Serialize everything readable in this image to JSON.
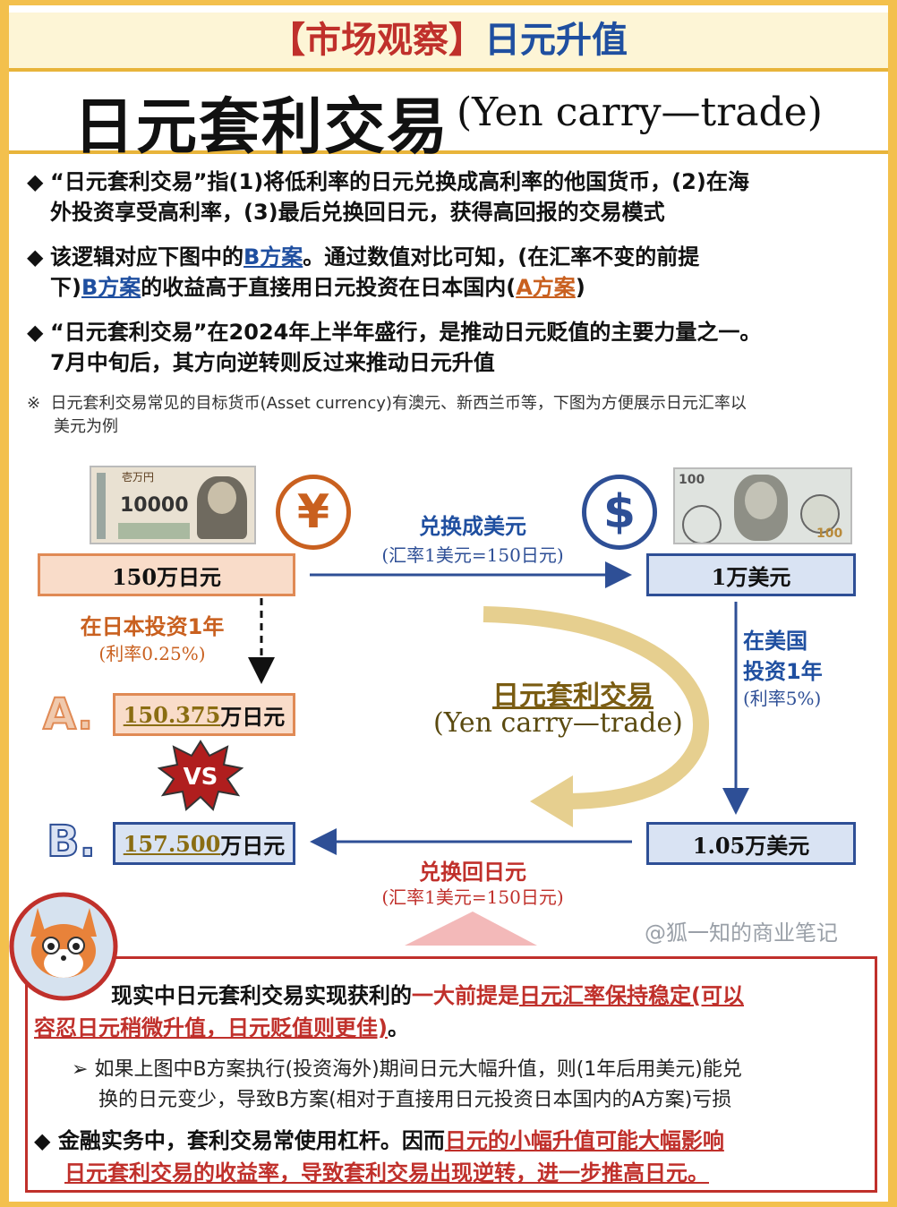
{
  "header": {
    "tag": "【市场观察】",
    "topic": "日元升值"
  },
  "title": {
    "main": "日元套利交易",
    "sub": "(Yen carry—trade)"
  },
  "bullets": [
    {
      "t1": "“日元套利交易”指(1)将低利率的日元兑换成高利率的他国货币，(2)在海",
      "t2": "外投资享受高利率，(3)最后兑换回日元，获得高回报的交易模式"
    },
    {
      "t1a": "该逻辑对应下图中的",
      "link1": "B方案",
      "t1b": "。通过数值对比可知，(在汇率不变的前提",
      "t2a": "下)",
      "link2": "B方案",
      "t2b": "的收益高于直接用日元投资在日本国内(",
      "link3": "A方案",
      "t2c": ")"
    },
    {
      "t1": "“日元套利交易”在2024年上半年盛行，是推动日元贬值的主要力量之一。",
      "t2": "7月中旬后，其方向逆转则反过来推动日元升值"
    }
  ],
  "note": {
    "mark": "※",
    "t1": "日元套利交易常见的目标货币(Asset currency)有澳元、新西兰币等，下图为方便展示日元汇率以",
    "t2": "美元为例"
  },
  "diagram": {
    "yen_bill_denom": "10000",
    "yen_bill_text": "壱万円",
    "yen_symbol": "¥",
    "usd_symbol": "$",
    "usd_bill_denom": "100",
    "start_box": "150万日元",
    "convert_label": "兑换成美元",
    "convert_rate": "(汇率1美元=150日元)",
    "usd_box": "1万美元",
    "jp_invest_label": "在日本投资1年",
    "jp_rate": "(利率0.25%)",
    "us_invest_l1": "在美国",
    "us_invest_l2": "投资1年",
    "us_rate": "(利率5%)",
    "option_a_letter": "A.",
    "option_a_value": "150.375",
    "option_a_unit": "万日元",
    "vs": "VS",
    "option_b_letter": "B.",
    "option_b_value": "157.500",
    "option_b_unit": "万日元",
    "usd_result_box": "1.05万美元",
    "back_label": "兑换回日元",
    "back_rate": "(汇率1美元=150日元)",
    "center_title": "日元套利交易",
    "center_sub": "(Yen carry—trade)"
  },
  "watermark": "@狐一知的商业笔记",
  "bottom": {
    "p1a": "现实中日元套利交易实现获利的",
    "p1b": "一大前提是",
    "p1c": "日元汇率保持稳定(可以",
    "p1d": "容忍日元稍微升值，日元贬值则更佳)",
    "p1e": "。",
    "arrow": "➢",
    "p2_l1": "如果上图中B方案执行(投资海外)期间日元大幅升值，则(1年后用美元)能兑",
    "p2_l2": "换的日元变少，导致B方案(相对于直接用日元投资日本国内的A方案)亏损",
    "p3a": "金融实务中，套利交易常使用杠杆。因而",
    "p3b": "日元的小幅升值可能大幅影响",
    "p3c": "日元套利交易的收益率，导致套利交易出现逆转，进一步推高日元。"
  },
  "colors": {
    "red": "#c0302b",
    "blue": "#1f4fa0",
    "orange": "#c9601f",
    "gold": "#f3c04d"
  }
}
